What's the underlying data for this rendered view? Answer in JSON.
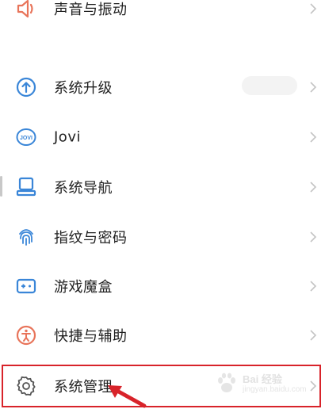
{
  "settings": {
    "items": [
      {
        "label": "声音与振动",
        "icon": "speaker-icon",
        "color": "#e8745a"
      },
      {
        "label": "系统升级",
        "icon": "upgrade-arrow-icon",
        "color": "#3a86d8"
      },
      {
        "label": "Jovi",
        "icon": "jovi-icon",
        "color": "#3a86d8"
      },
      {
        "label": "系统导航",
        "icon": "navigation-icon",
        "color": "#3a86d8"
      },
      {
        "label": "指纹与密码",
        "icon": "fingerprint-icon",
        "color": "#3a86d8"
      },
      {
        "label": "游戏魔盒",
        "icon": "game-box-icon",
        "color": "#3a86d8"
      },
      {
        "label": "快捷与辅助",
        "icon": "accessibility-icon",
        "color": "#e8745a"
      },
      {
        "label": "系统管理",
        "icon": "gear-icon",
        "color": "#555555"
      }
    ],
    "highlighted_item": "系统管理"
  },
  "annotation": {
    "highlight_color": "#d8232a",
    "arrow_color": "#d8232a"
  },
  "watermark": {
    "text": "Bai 经验",
    "sub": "jingyan.baidu.com"
  }
}
